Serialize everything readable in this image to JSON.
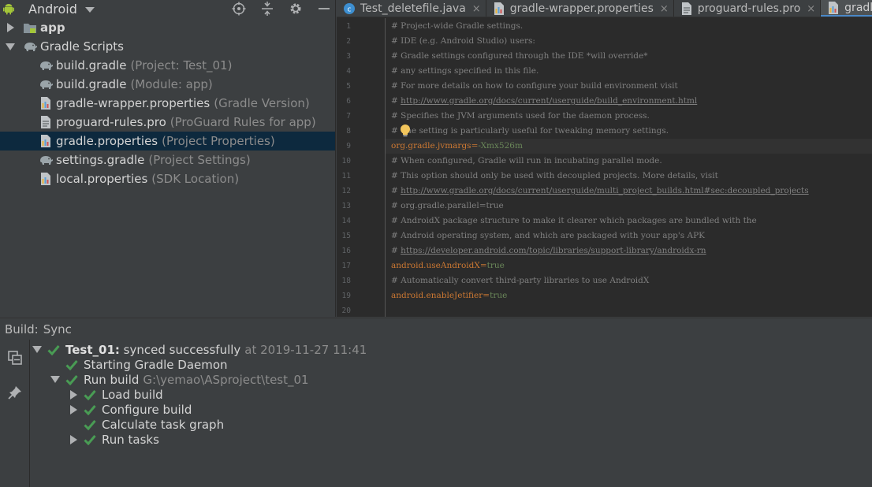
{
  "project": {
    "view_label": "Android",
    "tree": [
      {
        "label": "app",
        "hint": "",
        "bold": true,
        "arrow": "right",
        "icon": "module-folder-icon",
        "indent": 0
      },
      {
        "label": "Gradle Scripts",
        "hint": "",
        "bold": false,
        "arrow": "down",
        "icon": "gradle-scripts-icon",
        "indent": 0
      },
      {
        "label": "build.gradle",
        "hint": "(Project: Test_01)",
        "bold": false,
        "arrow": "",
        "icon": "gradle-elephant-icon",
        "indent": 1
      },
      {
        "label": "build.gradle",
        "hint": "(Module: app)",
        "bold": false,
        "arrow": "",
        "icon": "gradle-elephant-icon",
        "indent": 1
      },
      {
        "label": "gradle-wrapper.properties",
        "hint": "(Gradle Version)",
        "bold": false,
        "arrow": "",
        "icon": "properties-file-icon",
        "indent": 1
      },
      {
        "label": "proguard-rules.pro",
        "hint": "(ProGuard Rules for app)",
        "bold": false,
        "arrow": "",
        "icon": "text-file-icon",
        "indent": 1
      },
      {
        "label": "gradle.properties",
        "hint": "(Project Properties)",
        "bold": false,
        "arrow": "",
        "icon": "properties-file-icon",
        "indent": 1,
        "selected": true
      },
      {
        "label": "settings.gradle",
        "hint": "(Project Settings)",
        "bold": false,
        "arrow": "",
        "icon": "gradle-elephant-icon",
        "indent": 1
      },
      {
        "label": "local.properties",
        "hint": "(SDK Location)",
        "bold": false,
        "arrow": "",
        "icon": "properties-file-icon",
        "indent": 1
      }
    ]
  },
  "editor": {
    "tabs": [
      {
        "label": "Test_deletefile.java",
        "icon": "java-class-icon",
        "active": false
      },
      {
        "label": "gradle-wrapper.properties",
        "icon": "properties-file-icon",
        "active": false
      },
      {
        "label": "proguard-rules.pro",
        "icon": "text-file-icon",
        "active": false
      },
      {
        "label": "gradle.properties",
        "icon": "properties-file-icon",
        "active": true
      }
    ],
    "current_line": 9,
    "lines": [
      {
        "n": "1",
        "segs": [
          {
            "t": "# Project-wide Gradle settings.",
            "c": "comment"
          }
        ]
      },
      {
        "n": "2",
        "segs": [
          {
            "t": "# IDE (e.g. Android Studio) users:",
            "c": "comment"
          }
        ]
      },
      {
        "n": "3",
        "segs": [
          {
            "t": "# Gradle settings configured through the IDE *will override*",
            "c": "comment"
          }
        ]
      },
      {
        "n": "4",
        "segs": [
          {
            "t": "# any settings specified in this file.",
            "c": "comment"
          }
        ]
      },
      {
        "n": "5",
        "segs": [
          {
            "t": "# For more details on how to configure your build environment visit",
            "c": "comment"
          }
        ]
      },
      {
        "n": "6",
        "segs": [
          {
            "t": "# ",
            "c": "comment"
          },
          {
            "t": "http://www.gradle.org/docs/current/userguide/build_environment.html",
            "c": "link"
          }
        ]
      },
      {
        "n": "7",
        "segs": [
          {
            "t": "# Specifies the JVM arguments used for the daemon process.",
            "c": "comment"
          }
        ]
      },
      {
        "n": "8",
        "segs": [
          {
            "t": "# The setting is particularly useful for tweaking memory settings.",
            "c": "comment"
          }
        ]
      },
      {
        "n": "9",
        "segs": [
          {
            "t": "org.gradle.jvmargs",
            "c": "key"
          },
          {
            "t": "=",
            "c": "key"
          },
          {
            "t": "-Xmx526m",
            "c": "val"
          }
        ]
      },
      {
        "n": "10",
        "segs": [
          {
            "t": "# When configured, Gradle will run in incubating parallel mode.",
            "c": "comment"
          }
        ]
      },
      {
        "n": "11",
        "segs": [
          {
            "t": "# This option should only be used with decoupled projects. More details, visit",
            "c": "comment"
          }
        ]
      },
      {
        "n": "12",
        "segs": [
          {
            "t": "# ",
            "c": "comment"
          },
          {
            "t": "http://www.gradle.org/docs/current/userguide/multi_project_builds.html#sec:decoupled_projects",
            "c": "link"
          }
        ]
      },
      {
        "n": "13",
        "segs": [
          {
            "t": "# org.gradle.parallel=true",
            "c": "comment"
          }
        ]
      },
      {
        "n": "14",
        "segs": [
          {
            "t": "# AndroidX package structure to make it clearer which packages are bundled with the",
            "c": "comment"
          }
        ]
      },
      {
        "n": "15",
        "segs": [
          {
            "t": "# Android operating system, and which are packaged with your app's APK",
            "c": "comment"
          }
        ]
      },
      {
        "n": "16",
        "segs": [
          {
            "t": "# ",
            "c": "comment"
          },
          {
            "t": "https://developer.android.com/topic/libraries/support-library/androidx-rn",
            "c": "link"
          }
        ]
      },
      {
        "n": "17",
        "segs": [
          {
            "t": "android.useAndroidX",
            "c": "key"
          },
          {
            "t": "=",
            "c": "key"
          },
          {
            "t": "true",
            "c": "val"
          }
        ]
      },
      {
        "n": "18",
        "segs": [
          {
            "t": "# Automatically convert third-party libraries to use AndroidX",
            "c": "comment"
          }
        ]
      },
      {
        "n": "19",
        "segs": [
          {
            "t": "android.enableJetifier",
            "c": "key"
          },
          {
            "t": "=",
            "c": "key"
          },
          {
            "t": "true",
            "c": "val"
          }
        ]
      },
      {
        "n": "20",
        "segs": []
      }
    ]
  },
  "build": {
    "title": "Build:",
    "tab": "Sync",
    "rows": [
      {
        "arrow": "down",
        "label": "Test_01:",
        "strong": true,
        "text": " synced successfully",
        "muted": "at 2019-11-27 11:41",
        "level": 0
      },
      {
        "arrow": "",
        "label": "",
        "strong": false,
        "text": "Starting Gradle Daemon",
        "muted": "",
        "level": 1
      },
      {
        "arrow": "down",
        "label": "",
        "strong": false,
        "text": "Run build",
        "muted": "G:\\yemao\\ASproject\\test_01",
        "level": 1
      },
      {
        "arrow": "right",
        "label": "",
        "strong": false,
        "text": "Load build",
        "muted": "",
        "level": 2
      },
      {
        "arrow": "right",
        "label": "",
        "strong": false,
        "text": "Configure build",
        "muted": "",
        "level": 2
      },
      {
        "arrow": "",
        "label": "",
        "strong": false,
        "text": "Calculate task graph",
        "muted": "",
        "level": 2
      },
      {
        "arrow": "right",
        "label": "",
        "strong": false,
        "text": "Run tasks",
        "muted": "",
        "level": 2
      }
    ]
  },
  "colors": {
    "background": "#3c3f41",
    "editor_bg": "#2b2b2b",
    "selection": "#0d293e",
    "key": "#cc7832",
    "value": "#6a8759",
    "check_green": "#499c54",
    "active_tab_underline": "#4a88c7"
  }
}
